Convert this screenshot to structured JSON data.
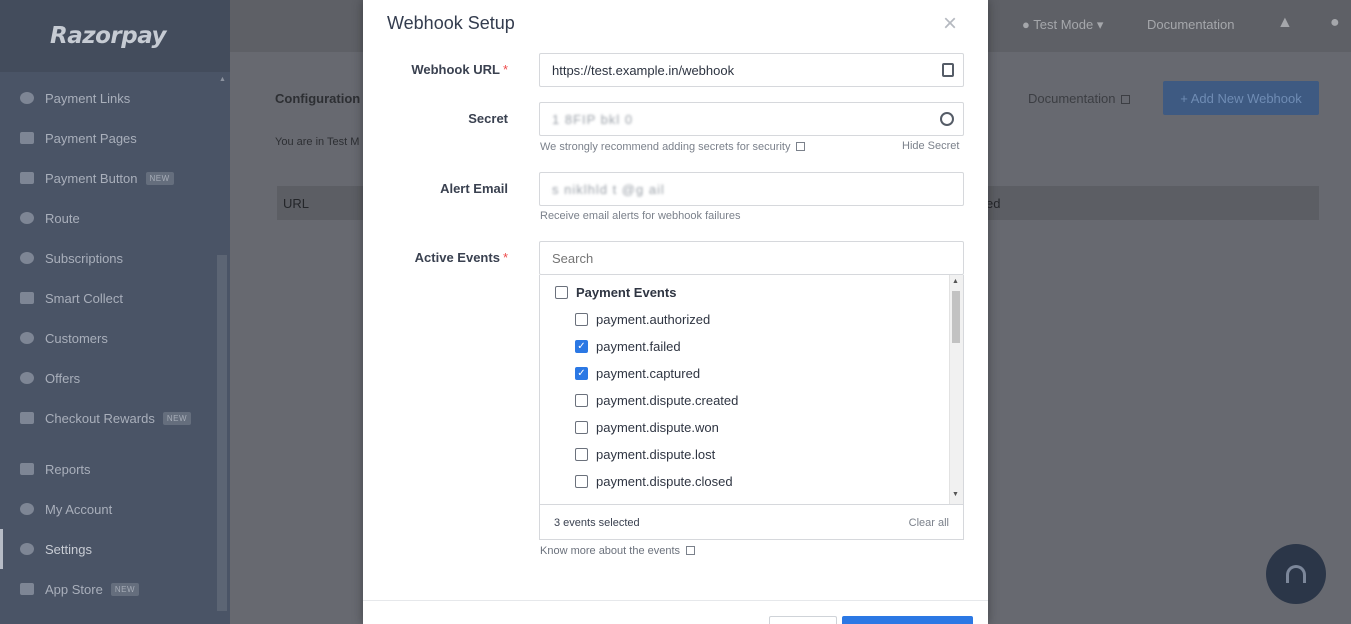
{
  "brand": {
    "logo_text": "Razorpay"
  },
  "sidebar": {
    "items": [
      {
        "label": "Payment Links"
      },
      {
        "label": "Payment Pages"
      },
      {
        "label": "Payment Button",
        "badge": "NEW"
      },
      {
        "label": "Route"
      },
      {
        "label": "Subscriptions"
      },
      {
        "label": "Smart Collect"
      },
      {
        "label": "Customers"
      },
      {
        "label": "Offers"
      },
      {
        "label": "Checkout Rewards",
        "badge": "NEW"
      },
      {
        "label": "Reports"
      },
      {
        "label": "My Account"
      },
      {
        "label": "Settings",
        "active": true
      },
      {
        "label": "App Store",
        "badge": "NEW"
      }
    ]
  },
  "topbar": {
    "mode": "Test Mode",
    "documentation": "Documentation"
  },
  "page": {
    "breadcrumb": "Configuration",
    "test_info": "You are in Test M",
    "documentation_link": "Documentation",
    "add_button": "+ Add New Webhook",
    "table_headers": {
      "url": "URL",
      "right": "ed"
    }
  },
  "modal": {
    "title": "Webhook Setup",
    "close": "×",
    "webhook_url": {
      "label": "Webhook URL",
      "required": "*",
      "value": "https://test.example.in/webhook"
    },
    "secret": {
      "label": "Secret",
      "value": "1  8FIP  bkl 0",
      "hint": "We strongly recommend adding secrets for security",
      "hide_label": "Hide Secret"
    },
    "alert_email": {
      "label": "Alert Email",
      "value": "s  niklhld  t    @g  ail   ",
      "hint": "Receive email alerts for webhook failures"
    },
    "active_events": {
      "label": "Active Events",
      "required": "*",
      "search_placeholder": "Search",
      "group": "Payment Events",
      "events": [
        {
          "name": "payment.authorized",
          "checked": false
        },
        {
          "name": "payment.failed",
          "checked": true
        },
        {
          "name": "payment.captured",
          "checked": true
        },
        {
          "name": "payment.dispute.created",
          "checked": false
        },
        {
          "name": "payment.dispute.won",
          "checked": false
        },
        {
          "name": "payment.dispute.lost",
          "checked": false
        },
        {
          "name": "payment.dispute.closed",
          "checked": false
        }
      ],
      "selected_count": "3 events selected",
      "clear_all": "Clear all"
    },
    "know_more": "Know more about the events"
  },
  "colors": {
    "primary": "#2b78e4",
    "sidebar_bg": "#4a5466",
    "overlay": "#676970"
  }
}
